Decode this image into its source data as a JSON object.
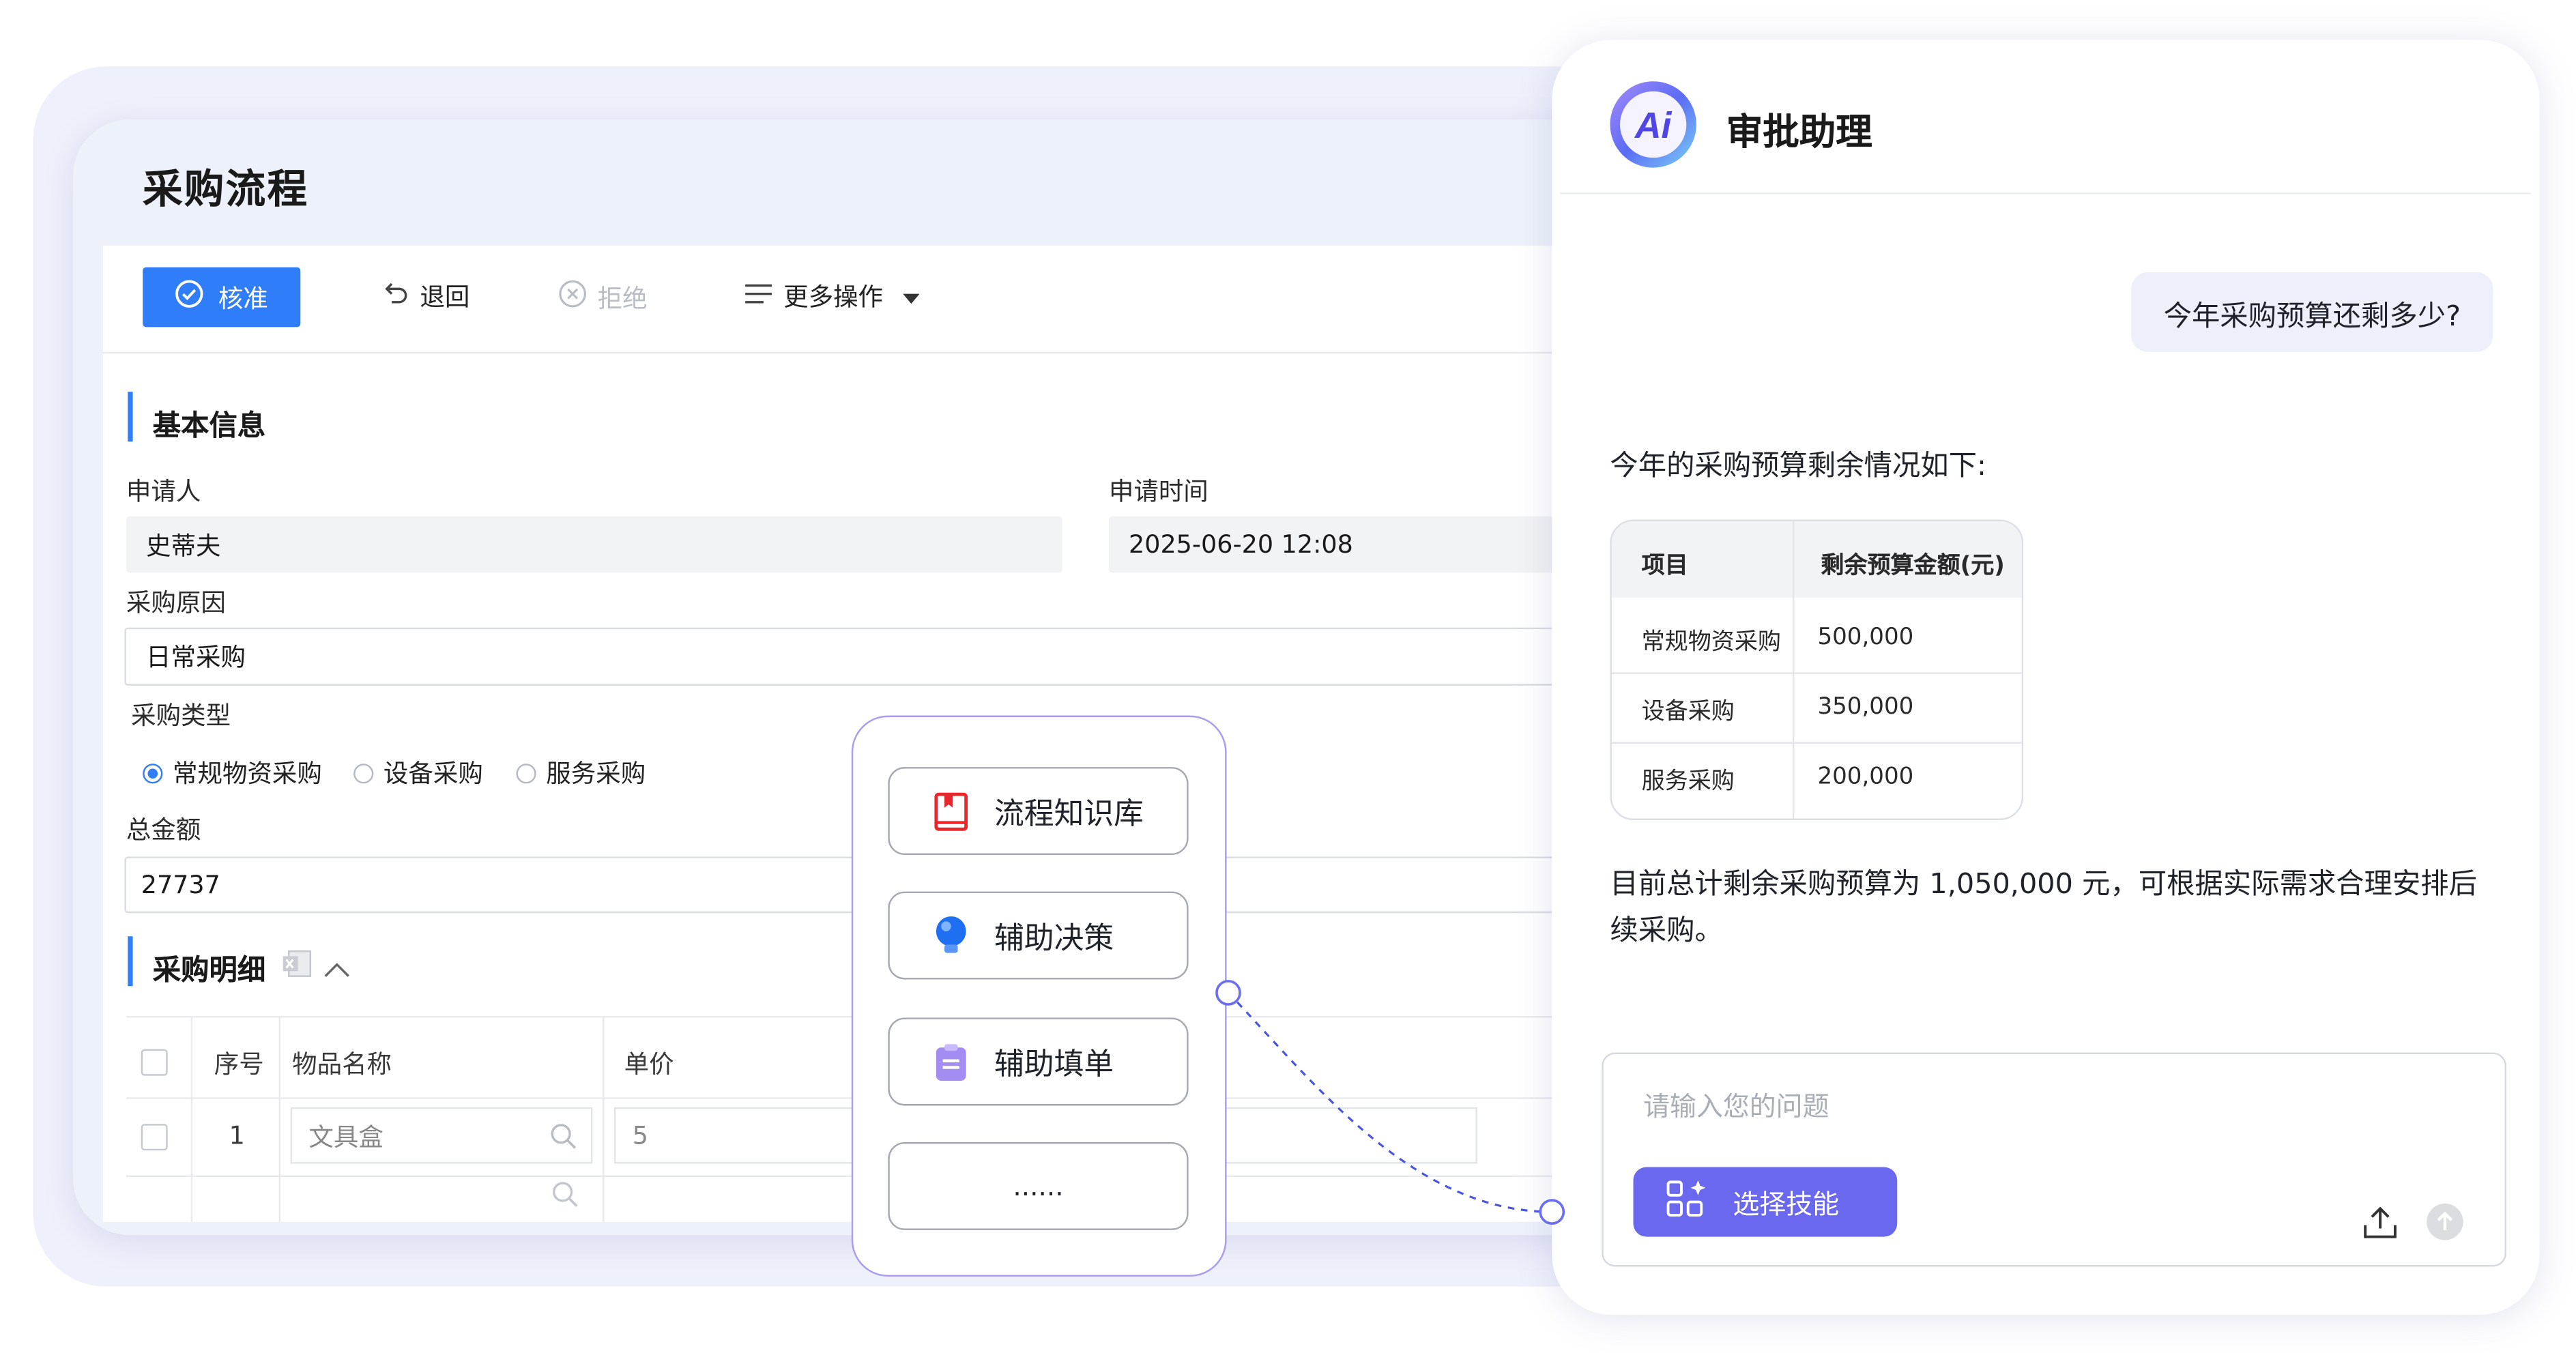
{
  "form": {
    "title": "采购流程",
    "toolbar": {
      "approve": "核准",
      "return": "退回",
      "reject": "拒绝",
      "more": "更多操作"
    },
    "basic_info": {
      "section_title": "基本信息",
      "applicant_label": "申请人",
      "applicant_value": "史蒂夫",
      "apply_time_label": "申请时间",
      "apply_time_value": "2025-06-20 12:08",
      "reason_label": "采购原因",
      "reason_value": "日常采购",
      "type_label": "采购类型",
      "type_options": [
        "常规物资采购",
        "设备采购",
        "服务采购"
      ],
      "type_selected": "常规物资采购",
      "total_label": "总金额",
      "total_value": "27737"
    },
    "detail": {
      "section_title": "采购明细",
      "columns": [
        "序号",
        "物品名称",
        "单价"
      ],
      "rows": [
        {
          "index": "1",
          "item_name": "文具盒",
          "price": "5"
        }
      ]
    }
  },
  "skills_popup": {
    "items": [
      "流程知识库",
      "辅助决策",
      "辅助填单",
      "......"
    ]
  },
  "assistant": {
    "logo_text": "Ai",
    "title": "审批助理",
    "user_question": "今年采购预算还剩多少?",
    "answer_intro": "今年的采购预算剩余情况如下:",
    "table": {
      "headers": [
        "项目",
        "剩余预算金额(元)"
      ],
      "rows": [
        [
          "常规物资采购",
          "500,000"
        ],
        [
          "设备采购",
          "350,000"
        ],
        [
          "服务采购",
          "200,000"
        ]
      ]
    },
    "answer_summary": "目前总计剩余采购预算为 1,050,000 元，可根据实际需求合理安排后续采购。",
    "input_placeholder": "请输入您的问题",
    "skill_button": "选择技能"
  },
  "colors": {
    "primary_blue": "#2f7df8",
    "skill_purple": "#6b68f0",
    "popup_border": "#a99bf2",
    "connector": "#4a55e0"
  }
}
